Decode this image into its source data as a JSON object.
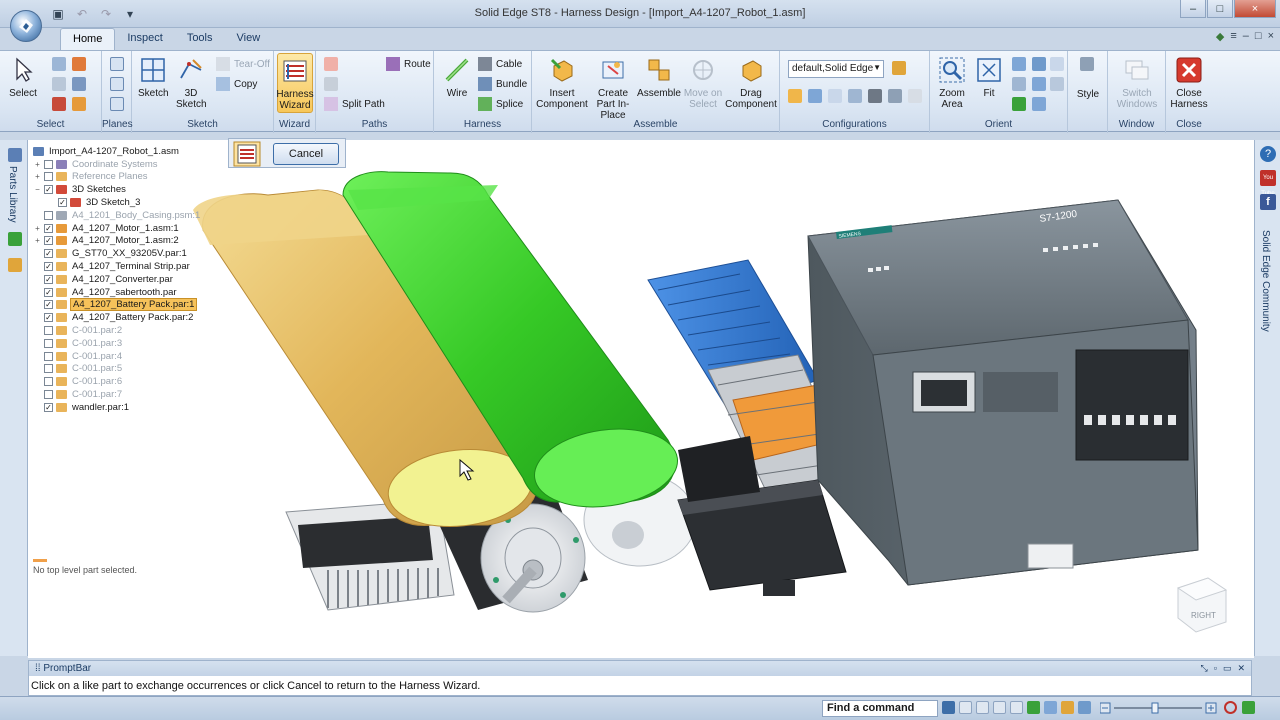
{
  "window": {
    "title": "Solid Edge ST8 - Harness Design - [Import_A4-1207_Robot_1.asm]",
    "controls": [
      "–",
      "□",
      "×"
    ],
    "doc_controls": [
      "–",
      "□",
      "×"
    ]
  },
  "tabs": [
    {
      "label": "Home",
      "active": true
    },
    {
      "label": "Inspect",
      "active": false
    },
    {
      "label": "Tools",
      "active": false
    },
    {
      "label": "View",
      "active": false
    }
  ],
  "ribbon": {
    "groups": {
      "select": "Select",
      "planes": "Planes",
      "sketch": "Sketch",
      "wizard": "Wizard",
      "paths": "Paths",
      "harness": "Harness",
      "assemble": "Assemble",
      "configurations": "Configurations",
      "orient": "Orient",
      "window": "Window",
      "close": "Close"
    },
    "buttons": {
      "select": "Select",
      "sketch": "Sketch",
      "sketch3d": "3D Sketch",
      "tear_off": "Tear-Off",
      "copy": "Copy",
      "harness_wizard": "Harness Wizard",
      "route": "Route",
      "split_path": "Split Path",
      "wire": "Wire",
      "cable": "Cable",
      "bundle": "Bundle",
      "splice": "Splice",
      "insert_component": "Insert Component",
      "create_part_in_place": "Create Part In-Place",
      "assemble": "Assemble",
      "move_on_select": "Move on Select",
      "drag_component": "Drag Component",
      "zoom_area": "Zoom Area",
      "fit": "Fit",
      "style": "Style",
      "switch_windows": "Switch Windows",
      "close_harness": "Close Harness"
    },
    "configuration_value": "default,Solid Edge"
  },
  "sidebar": {
    "parts_library": "Parts Library",
    "community": "Solid Edge Community",
    "youtube": "You Tube",
    "facebook": "f"
  },
  "dialog": {
    "cancel": "Cancel"
  },
  "tree": [
    {
      "label": "Import_A4-1207_Robot_1.asm",
      "exp": "",
      "cb": "",
      "dim": false,
      "sel": false,
      "icon": "#5b7fb5",
      "root": true
    },
    {
      "label": "Coordinate Systems",
      "exp": "+",
      "cb": "",
      "dim": true,
      "sel": false,
      "icon": "#8a7fb8"
    },
    {
      "label": "Reference Planes",
      "exp": "+",
      "cb": "",
      "dim": true,
      "sel": false,
      "icon": "#e9b45a"
    },
    {
      "label": "3D Sketches",
      "exp": "−",
      "cb": "✓",
      "dim": false,
      "sel": false,
      "icon": "#d24a3a"
    },
    {
      "label": "3D Sketch_3",
      "exp": "",
      "cb": "✓",
      "dim": false,
      "sel": false,
      "icon": "#d24a3a",
      "indent": true
    },
    {
      "label": "A4_1201_Body_Casing.psm:1",
      "exp": "",
      "cb": "",
      "dim": true,
      "sel": false,
      "icon": "#9fa8b5"
    },
    {
      "label": "A4_1207_Motor_1.asm:1",
      "exp": "+",
      "cb": "✓",
      "dim": false,
      "sel": false,
      "icon": "#e79a3a"
    },
    {
      "label": "A4_1207_Motor_1.asm:2",
      "exp": "+",
      "cb": "✓",
      "dim": false,
      "sel": false,
      "icon": "#e79a3a"
    },
    {
      "label": "G_ST70_XX_93205V.par:1",
      "exp": "",
      "cb": "✓",
      "dim": false,
      "sel": false,
      "icon": "#e9b45a"
    },
    {
      "label": "A4_1207_Terminal Strip.par",
      "exp": "",
      "cb": "✓",
      "dim": false,
      "sel": false,
      "icon": "#e9b45a"
    },
    {
      "label": "A4_1207_Converter.par",
      "exp": "",
      "cb": "✓",
      "dim": false,
      "sel": false,
      "icon": "#e9b45a"
    },
    {
      "label": "A4_1207_sabertooth.par",
      "exp": "",
      "cb": "✓",
      "dim": false,
      "sel": false,
      "icon": "#e9b45a"
    },
    {
      "label": "A4_1207_Battery Pack.par:1",
      "exp": "",
      "cb": "✓",
      "dim": false,
      "sel": true,
      "icon": "#e9b45a"
    },
    {
      "label": "A4_1207_Battery Pack.par:2",
      "exp": "",
      "cb": "✓",
      "dim": false,
      "sel": false,
      "icon": "#e9b45a"
    },
    {
      "label": "C-001.par:2",
      "exp": "",
      "cb": "",
      "dim": true,
      "sel": false,
      "icon": "#e9b45a"
    },
    {
      "label": "C-001.par:3",
      "exp": "",
      "cb": "",
      "dim": true,
      "sel": false,
      "icon": "#e9b45a"
    },
    {
      "label": "C-001.par:4",
      "exp": "",
      "cb": "",
      "dim": true,
      "sel": false,
      "icon": "#e9b45a"
    },
    {
      "label": "C-001.par:5",
      "exp": "",
      "cb": "",
      "dim": true,
      "sel": false,
      "icon": "#e9b45a"
    },
    {
      "label": "C-001.par:6",
      "exp": "",
      "cb": "",
      "dim": true,
      "sel": false,
      "icon": "#e9b45a"
    },
    {
      "label": "C-001.par:7",
      "exp": "",
      "cb": "",
      "dim": true,
      "sel": false,
      "icon": "#e9b45a"
    },
    {
      "label": "wandler.par:1",
      "exp": "",
      "cb": "✓",
      "dim": false,
      "sel": false,
      "icon": "#e9b45a"
    }
  ],
  "status": {
    "no_part": "No top level part selected."
  },
  "view_cube": {
    "face": "RIGHT"
  },
  "promptbar": {
    "title": "PromptBar",
    "text": "Click on a like part to exchange occurrences or click Cancel to return to the Harness Wizard."
  },
  "statusbar": {
    "find_command": "Find a command"
  },
  "colors": {
    "battery_yellow": "#e2b65a",
    "battery_green": "#3fd12e",
    "plc_gray": "#5f6a70",
    "terminal_blue": "#2f74d0",
    "terminal_orange": "#f09a3a",
    "selection": "#f6c25a"
  },
  "labels": {
    "plc_brand": "SIEMENS",
    "plc_model": "S7-1200"
  }
}
